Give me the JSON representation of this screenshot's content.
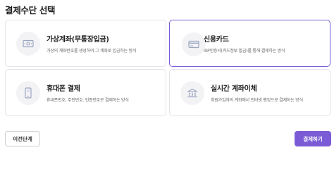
{
  "page": {
    "title": "결제수단 선택"
  },
  "methods": [
    {
      "title": "가상계좌(무통장입금)",
      "desc": "가상의 계좌번호를 생성하여 그 계좌로 입금하는 방식",
      "icon": "cash-icon",
      "selected": false
    },
    {
      "title": "신용카드",
      "desc": "ISP인증서(카드정보 발급)를 통해 결제하는 방식",
      "icon": "credit-card-icon",
      "selected": true
    },
    {
      "title": "휴대폰 결제",
      "desc": "휴대폰번호, 주민번호, 인증번호로 결제하는 방식",
      "icon": "mobile-phone-icon",
      "selected": false
    },
    {
      "title": "실시간 계좌이체",
      "desc": "회원가입자의 계좌에서 인터넷 뱅킹으로 결제하는 방식",
      "icon": "bank-icon",
      "selected": false
    }
  ],
  "buttons": {
    "prev_label": "이전단계",
    "pay_label": "결제하기"
  },
  "colors": {
    "accent": "#7b5cd6",
    "icon_bg": "#f3f3f6",
    "icon_stroke": "#9aa6c0"
  }
}
